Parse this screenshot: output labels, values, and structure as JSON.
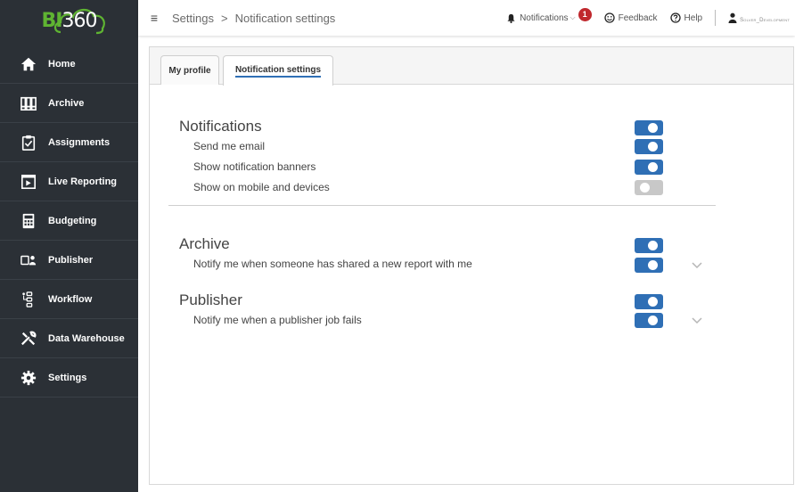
{
  "logo": {
    "brand_bi": "BI",
    "brand_360": "360"
  },
  "sidebar": {
    "items": [
      {
        "label": "Home",
        "icon": "home-icon"
      },
      {
        "label": "Archive",
        "icon": "archive-icon"
      },
      {
        "label": "Assignments",
        "icon": "clipboard-icon"
      },
      {
        "label": "Live Reporting",
        "icon": "report-icon"
      },
      {
        "label": "Budgeting",
        "icon": "calculator-icon"
      },
      {
        "label": "Publisher",
        "icon": "publisher-icon"
      },
      {
        "label": "Workflow",
        "icon": "workflow-icon"
      },
      {
        "label": "Data Warehouse",
        "icon": "tools-icon"
      },
      {
        "label": "Settings",
        "icon": "gear-icon"
      }
    ]
  },
  "header": {
    "breadcrumb": {
      "root": "Settings",
      "separator": ">",
      "current": "Notification settings"
    },
    "notifications_label": "Notifications",
    "notifications_count": "1",
    "feedback_label": "Feedback",
    "help_label": "Help",
    "user_name": "Solver_Development"
  },
  "tabs": [
    {
      "label": "My profile",
      "active": false
    },
    {
      "label": "Notification settings",
      "active": true
    }
  ],
  "notifications": {
    "title": "Notifications",
    "master_on": true,
    "rows": [
      {
        "label": "Send me email",
        "on": true
      },
      {
        "label": "Show notification banners",
        "on": true
      },
      {
        "label": "Show on mobile and devices",
        "on": false
      }
    ]
  },
  "archive": {
    "title": "Archive",
    "master_on": true,
    "row": {
      "label": "Notify me when someone has shared a new report with me",
      "on": true
    }
  },
  "publisher": {
    "title": "Publisher",
    "master_on": true,
    "row": {
      "label": "Notify me when a publisher job fails",
      "on": true
    }
  },
  "colors": {
    "sidebar_bg": "#2b3036",
    "accent_green": "#5fb432",
    "toggle_on": "#2f6fb5",
    "toggle_off": "#c8c8c8",
    "badge_red": "#c0282d"
  }
}
